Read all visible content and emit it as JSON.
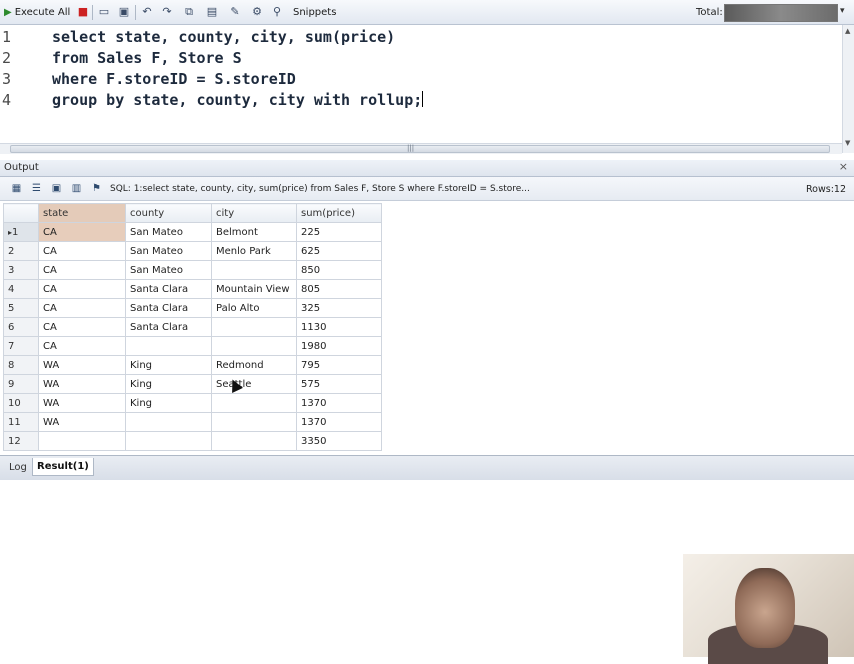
{
  "toolbar": {
    "execute_label": "Execute All",
    "snippets_label": "Snippets",
    "total_label": "Total:",
    "icons": [
      "stop-icon",
      "new-icon",
      "save-icon",
      "undo-icon",
      "redo-icon",
      "copy-icon",
      "paste-icon",
      "clear-icon",
      "settings-icon",
      "find-icon"
    ]
  },
  "editor": {
    "lines": [
      {
        "number": "1",
        "text": "select state, county, city, sum(price)"
      },
      {
        "number": "2",
        "text": "from Sales F, Store S"
      },
      {
        "number": "3",
        "text": "where F.storeID = S.storeID"
      },
      {
        "number": "4",
        "text": "group by state, county, city with rollup;"
      }
    ]
  },
  "output": {
    "title": "Output",
    "sql_summary": "SQL: 1:select state, county, city, sum(price)  from Sales F, Store S  where F.storeID = S.store...",
    "rows_label": "Rows:12",
    "columns": [
      "state",
      "county",
      "city",
      "sum(price)"
    ],
    "rows": [
      [
        "1",
        "CA",
        "San Mateo",
        "Belmont",
        "225"
      ],
      [
        "2",
        "CA",
        "San Mateo",
        "Menlo Park",
        "625"
      ],
      [
        "3",
        "CA",
        "San Mateo",
        "",
        "850"
      ],
      [
        "4",
        "CA",
        "Santa Clara",
        "Mountain View",
        "805"
      ],
      [
        "5",
        "CA",
        "Santa Clara",
        "Palo Alto",
        "325"
      ],
      [
        "6",
        "CA",
        "Santa Clara",
        "",
        "1130"
      ],
      [
        "7",
        "CA",
        "",
        "",
        "1980"
      ],
      [
        "8",
        "WA",
        "King",
        "Redmond",
        "795"
      ],
      [
        "9",
        "WA",
        "King",
        "Seattle",
        "575"
      ],
      [
        "10",
        "WA",
        "King",
        "",
        "1370"
      ],
      [
        "11",
        "WA",
        "",
        "",
        "1370"
      ],
      [
        "12",
        "",
        "",
        "",
        "3350"
      ]
    ]
  },
  "tabs": {
    "log": "Log",
    "result": "Result(1)"
  }
}
